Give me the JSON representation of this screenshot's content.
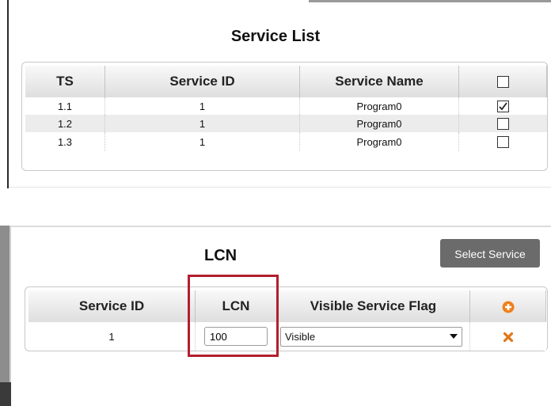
{
  "service_list": {
    "title": "Service List",
    "columns": [
      "TS",
      "Service ID",
      "Service Name"
    ],
    "rows": [
      {
        "ts": "1.1",
        "service_id": "1",
        "service_name": "Program0",
        "checked": true
      },
      {
        "ts": "1.2",
        "service_id": "1",
        "service_name": "Program0",
        "checked": false
      },
      {
        "ts": "1.3",
        "service_id": "1",
        "service_name": "Program0",
        "checked": false
      }
    ],
    "select_all_checked": false
  },
  "lcn": {
    "title": "LCN",
    "select_service_label": "Select Service",
    "columns": [
      "Service ID",
      "LCN",
      "Visible Service Flag"
    ],
    "add_icon": "plus-circle-icon",
    "remove_icon": "delete-x-icon",
    "row": {
      "service_id": "1",
      "lcn_value": "100",
      "visible_flag": "Visible"
    }
  },
  "colors": {
    "highlight": "#b21f2d",
    "add_icon": "#f07f1a",
    "remove_icon": "#e07818",
    "button_bg": "#6b6b6b"
  }
}
